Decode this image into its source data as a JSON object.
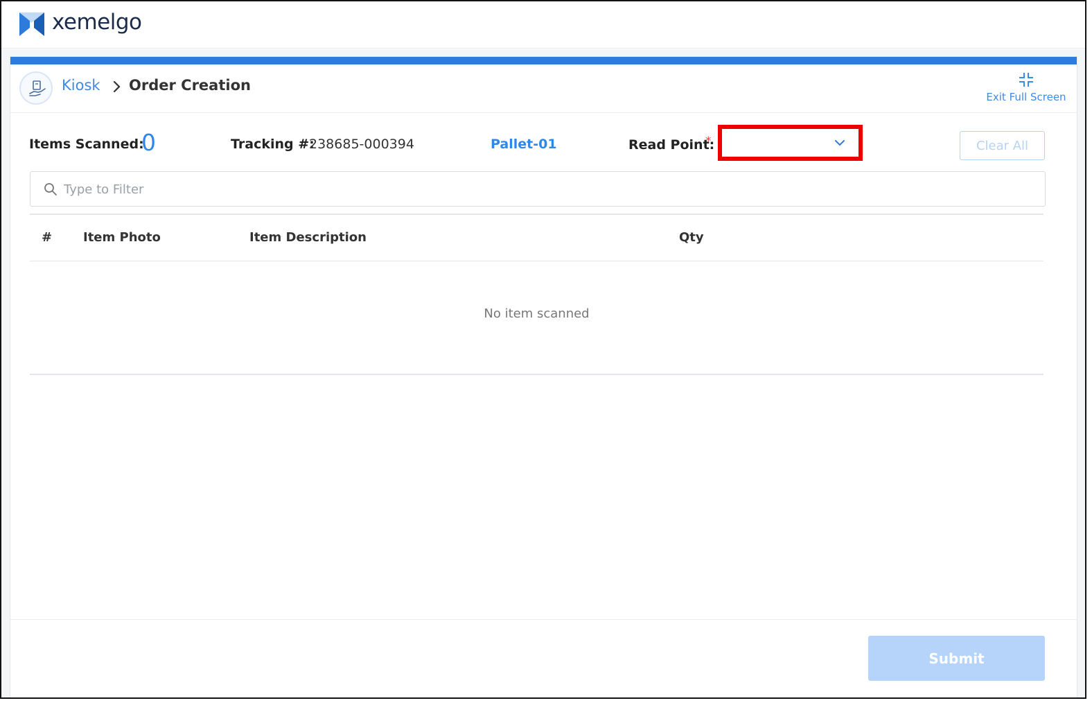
{
  "app": {
    "brand_name": "xemelgo",
    "brand_color": "#2f7bdc",
    "logo_icon": "xemelgo-logo-mark"
  },
  "breadcrumb": {
    "icon": "kiosk-hand-package-icon",
    "root": "Kiosk",
    "separator_icon": "chevron-right-icon",
    "current": "Order Creation"
  },
  "header": {
    "exit_fullscreen_icon": "collapse-fullscreen-icon",
    "exit_fullscreen_label": "Exit Full Screen"
  },
  "stats": {
    "items_scanned_label": "Items Scanned:",
    "items_scanned_value": "0",
    "tracking_label": "Tracking #:",
    "tracking_value": "238685-000394",
    "pallet_value": "Pallet-01",
    "read_point_label": "Read Point:",
    "read_point_required": "*",
    "read_point_selected": "",
    "read_point_highlight_color": "#ee0000"
  },
  "actions": {
    "clear_all_label": "Clear All",
    "submit_label": "Submit"
  },
  "filter": {
    "placeholder": "Type to Filter",
    "value": "",
    "icon": "search-icon"
  },
  "table": {
    "columns": [
      "#",
      "Item Photo",
      "Item Description",
      "Qty"
    ],
    "rows": [],
    "empty_message": "No item scanned"
  }
}
